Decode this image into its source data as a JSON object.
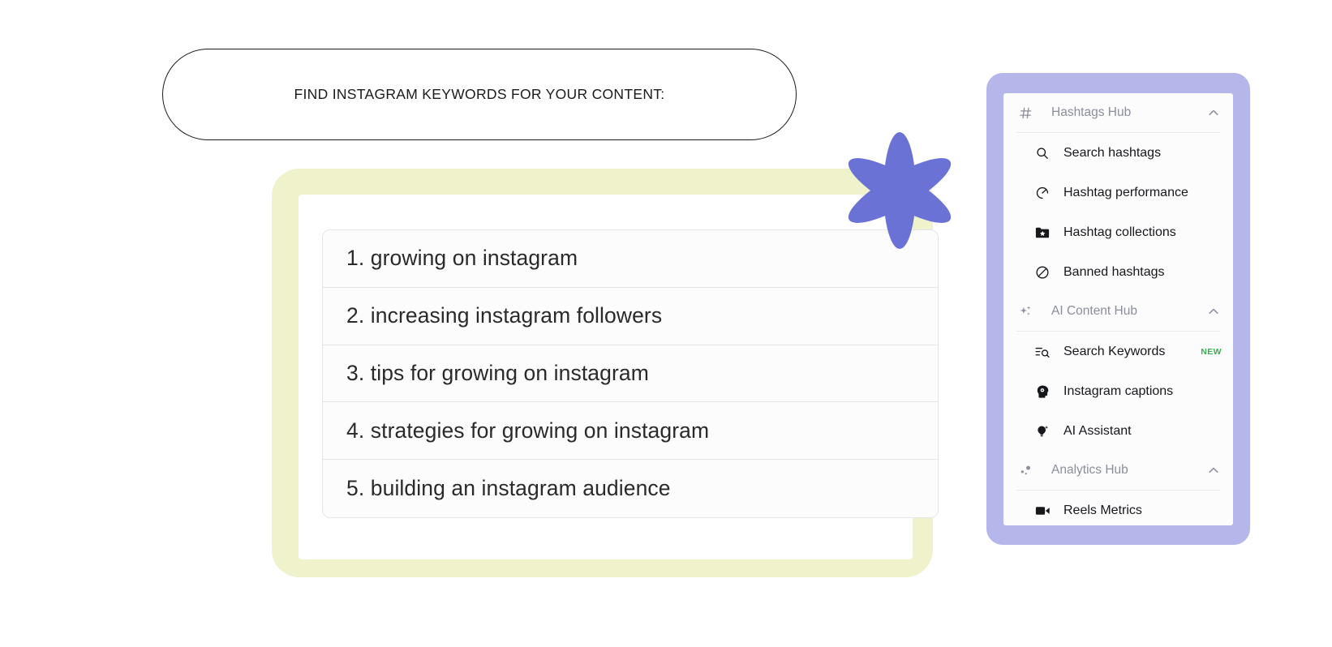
{
  "header": {
    "title": "FIND INSTAGRAM KEYWORDS FOR YOUR CONTENT:"
  },
  "keywords": {
    "items": [
      "1. growing on instagram",
      "2. increasing instagram followers",
      "3. tips for growing on instagram",
      "4. strategies for growing on instagram",
      "5. building an instagram audience"
    ]
  },
  "sidebar": {
    "sections": [
      {
        "label": "Hashtags Hub",
        "icon": "hash-icon",
        "chevron": "chevron-up-icon",
        "items": [
          {
            "label": "Search hashtags",
            "icon": "search-icon",
            "badge": ""
          },
          {
            "label": "Hashtag performance",
            "icon": "gauge-icon",
            "badge": ""
          },
          {
            "label": "Hashtag collections",
            "icon": "folder-star-icon",
            "badge": ""
          },
          {
            "label": "Banned hashtags",
            "icon": "no-entry-icon",
            "badge": ""
          }
        ]
      },
      {
        "label": "AI Content Hub",
        "icon": "sparkles-icon",
        "chevron": "chevron-up-icon",
        "items": [
          {
            "label": "Search Keywords",
            "icon": "list-search-icon",
            "badge": "NEW"
          },
          {
            "label": "Instagram captions",
            "icon": "head-gear-icon",
            "badge": ""
          },
          {
            "label": "AI Assistant",
            "icon": "bulb-sparkle-icon",
            "badge": ""
          }
        ]
      },
      {
        "label": "Analytics Hub",
        "icon": "scatter-dots-icon",
        "chevron": "chevron-up-icon",
        "items": [
          {
            "label": "Reels Metrics",
            "icon": "video-camera-icon",
            "badge": ""
          }
        ]
      }
    ]
  },
  "decor": {
    "flower_color": "#6b72d6",
    "frame_yellow": "#eff2cb",
    "sidebar_purple": "#b5b6ea",
    "badge_green": "#3cad52"
  }
}
